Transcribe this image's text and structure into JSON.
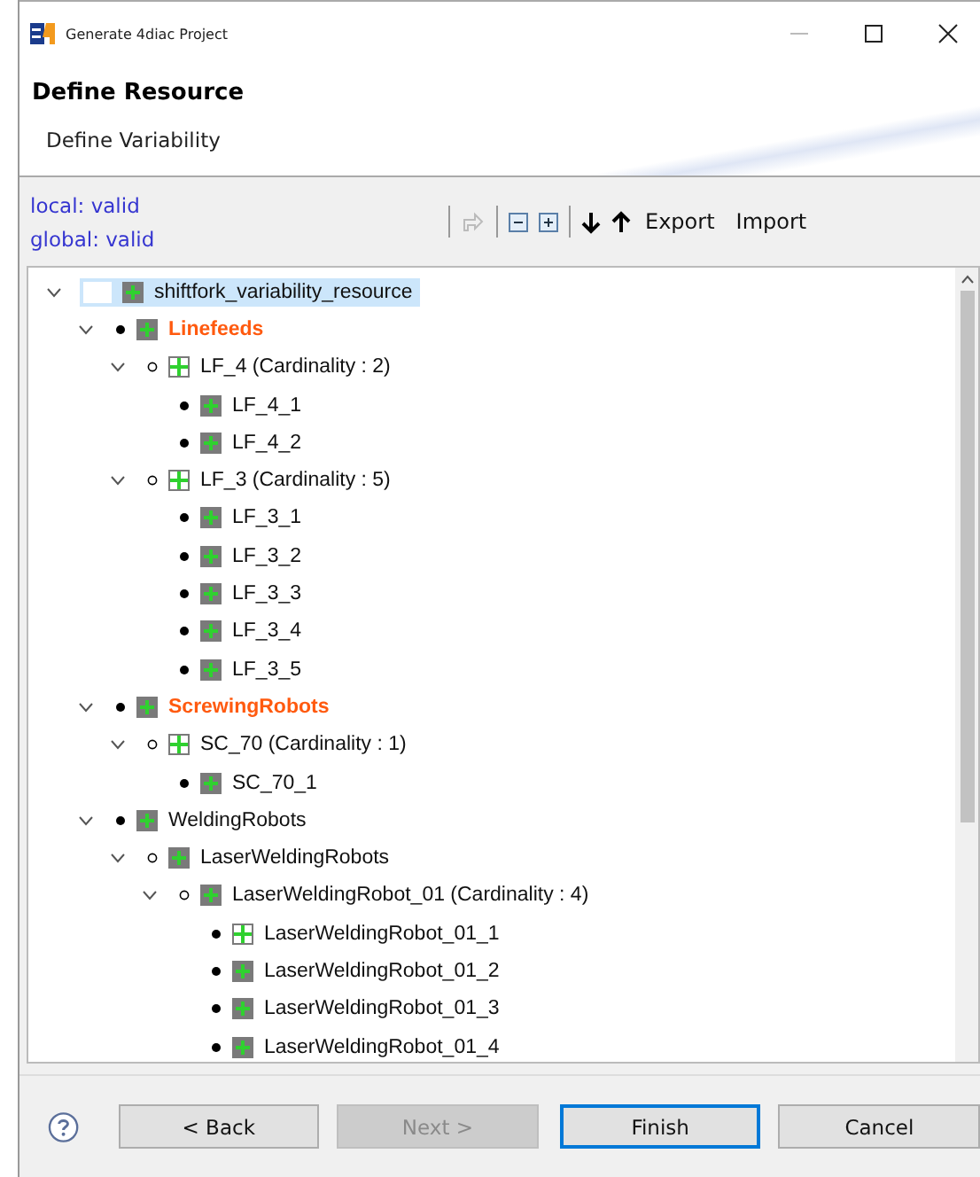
{
  "window": {
    "title": "Generate 4diac Project"
  },
  "header": {
    "title": "Define Resource",
    "description": "Define Variability"
  },
  "status": [
    "local: valid",
    "global: valid"
  ],
  "toolbar": {
    "buttons": [
      {
        "kind": "link",
        "disabled": true
      },
      {
        "kind": "collapse",
        "disabled": false
      },
      {
        "kind": "expand",
        "disabled": false
      },
      {
        "kind": "down",
        "disabled": false
      },
      {
        "kind": "up",
        "disabled": false
      }
    ],
    "export": "Export",
    "import": "Import"
  },
  "tree": [
    {
      "label": "shiftfork_variability_resource",
      "kind": "root",
      "highlight": false,
      "selected": true,
      "expanded": true,
      "children": [
        {
          "label": "Linefeeds",
          "kind": "mandatory",
          "highlight": true,
          "selected": false,
          "expanded": true,
          "children": [
            {
              "label": "LF_4 (Cardinality : 2)",
              "kind": "cardinality",
              "highlight": false,
              "selected": false,
              "expanded": true,
              "children": [
                {
                  "label": "LF_4_1",
                  "kind": "mandatory",
                  "highlight": false,
                  "selected": false
                },
                {
                  "label": "LF_4_2",
                  "kind": "mandatory",
                  "highlight": false,
                  "selected": false
                }
              ]
            },
            {
              "label": "LF_3 (Cardinality : 5)",
              "kind": "cardinality",
              "highlight": false,
              "selected": false,
              "expanded": true,
              "children": [
                {
                  "label": "LF_3_1",
                  "kind": "mandatory",
                  "highlight": false,
                  "selected": false
                },
                {
                  "label": "LF_3_2",
                  "kind": "mandatory",
                  "highlight": false,
                  "selected": false
                },
                {
                  "label": "LF_3_3",
                  "kind": "mandatory",
                  "highlight": false,
                  "selected": false
                },
                {
                  "label": "LF_3_4",
                  "kind": "mandatory",
                  "highlight": false,
                  "selected": false
                },
                {
                  "label": "LF_3_5",
                  "kind": "mandatory",
                  "highlight": false,
                  "selected": false
                }
              ]
            }
          ]
        },
        {
          "label": "ScrewingRobots",
          "kind": "mandatory",
          "highlight": true,
          "selected": false,
          "expanded": true,
          "children": [
            {
              "label": "SC_70 (Cardinality : 1)",
              "kind": "cardinality",
              "highlight": false,
              "selected": false,
              "expanded": true,
              "children": [
                {
                  "label": "SC_70_1",
                  "kind": "mandatory",
                  "highlight": false,
                  "selected": false
                }
              ]
            }
          ]
        },
        {
          "label": "WeldingRobots",
          "kind": "mandatory",
          "highlight": false,
          "selected": false,
          "expanded": true,
          "children": [
            {
              "label": "LaserWeldingRobots",
              "kind": "optional",
              "highlight": false,
              "selected": false,
              "expanded": true,
              "children": [
                {
                  "label": "LaserWeldingRobot_01 (Cardinality : 4)",
                  "kind": "optional",
                  "highlight": false,
                  "selected": false,
                  "expanded": true,
                  "children": [
                    {
                      "label": "LaserWeldingRobot_01_1",
                      "kind": "instance",
                      "highlight": false,
                      "selected": false
                    },
                    {
                      "label": "LaserWeldingRobot_01_2",
                      "kind": "mandatory",
                      "highlight": false,
                      "selected": false
                    },
                    {
                      "label": "LaserWeldingRobot_01_3",
                      "kind": "mandatory",
                      "highlight": false,
                      "selected": false
                    },
                    {
                      "label": "LaserWeldingRobot_01_4",
                      "kind": "mandatory",
                      "highlight": false,
                      "selected": false
                    }
                  ]
                }
              ]
            }
          ]
        }
      ]
    }
  ],
  "buttons": [
    {
      "label": "< Back",
      "disabled": false,
      "default": false
    },
    {
      "label": "Next >",
      "disabled": true,
      "default": false
    },
    {
      "label": "Finish",
      "disabled": false,
      "default": true
    },
    {
      "label": "Cancel",
      "disabled": false,
      "default": false
    }
  ]
}
